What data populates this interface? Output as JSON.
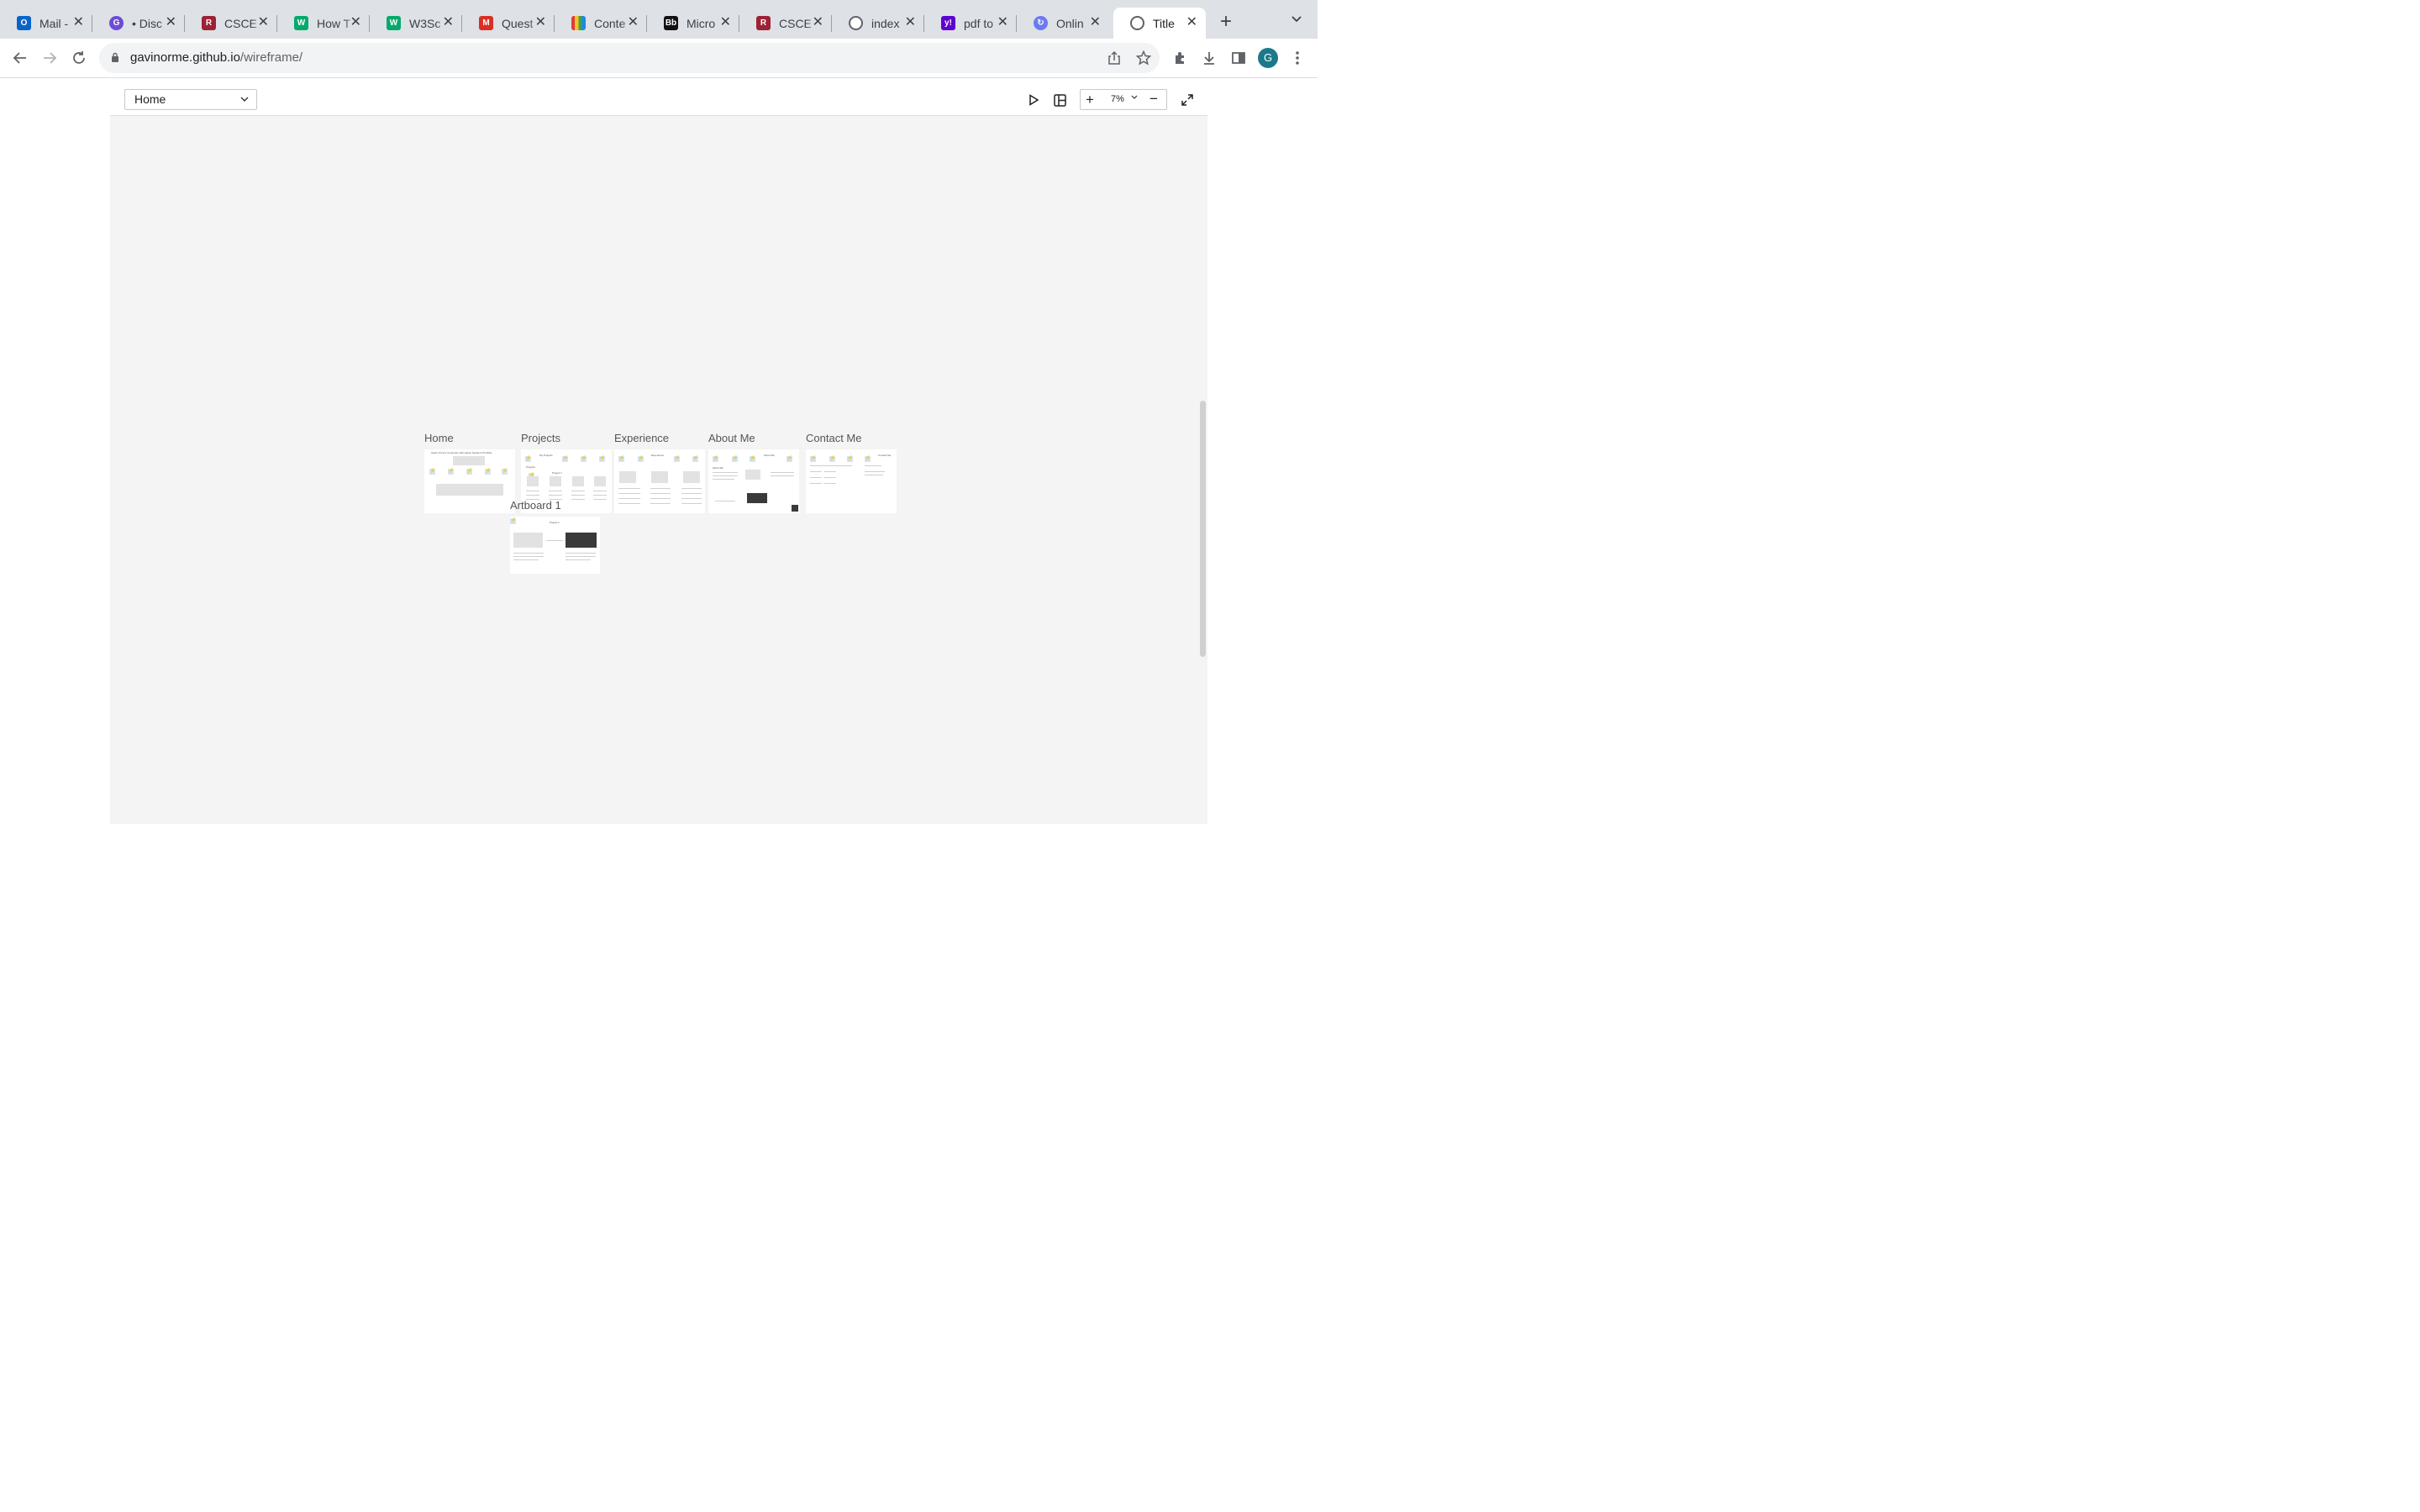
{
  "browser": {
    "tabs": [
      {
        "title": "Mail -",
        "icon": "outlook-icon",
        "color": "#0a64c8"
      },
      {
        "title": "• Disc",
        "icon": "discussion-icon",
        "color": "#6c4bd8"
      },
      {
        "title": "CSCE",
        "icon": "razorback-icon",
        "color": "#9d2235"
      },
      {
        "title": "How T",
        "icon": "w3schools-icon",
        "color": "#04aa6d"
      },
      {
        "title": "W3Sc",
        "icon": "w3schools-icon",
        "color": "#04aa6d"
      },
      {
        "title": "Quest",
        "icon": "m-icon",
        "color": "#d93025"
      },
      {
        "title": "Conte",
        "icon": "bar-chart-icon",
        "color": "#222222"
      },
      {
        "title": "Micro",
        "icon": "blackboard-icon",
        "color": "#111111"
      },
      {
        "title": "CSCE",
        "icon": "razorback-icon",
        "color": "#9d2235"
      },
      {
        "title": "index",
        "icon": "globe-icon",
        "color": "#5f6368"
      },
      {
        "title": "pdf to",
        "icon": "yahoo-icon",
        "color": "#5f01d1"
      },
      {
        "title": "Onlin",
        "icon": "sync-icon",
        "color": "#6b7bf0"
      },
      {
        "title": "Title",
        "icon": "globe-icon",
        "color": "#5f6368",
        "active": true
      }
    ],
    "url_host": "gavinorme.github.io",
    "url_path": "/wireframe/",
    "avatar_initial": "G"
  },
  "viewer": {
    "page_select": "Home",
    "zoom": "7%"
  },
  "artboards": [
    {
      "label": "Home"
    },
    {
      "label": "Projects"
    },
    {
      "label": "Experience"
    },
    {
      "label": "About Me"
    },
    {
      "label": "Contact Me"
    },
    {
      "label": "Artboard 1"
    }
  ],
  "thumb_text": {
    "home_title": "Gavin Orme's Computer Information Systems Portfolio",
    "projects_title": "My Projects",
    "projects_sub": "Projects",
    "projects_item": "Project 1",
    "experience_title": "Experience",
    "about_title": "About Me",
    "contact_title": "Contact Me",
    "artboard_title": "Project 1"
  }
}
